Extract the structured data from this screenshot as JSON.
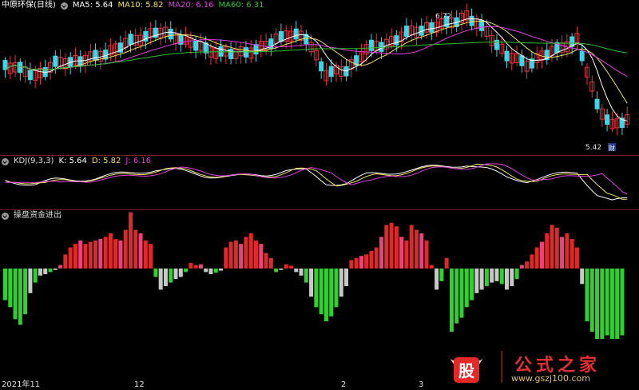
{
  "header_price": {
    "stock": "中原环保(日线)",
    "items": [
      {
        "label": "MA5: 5.64",
        "color": "#ffffff"
      },
      {
        "label": "MA10: 5.82",
        "color": "#f0e060"
      },
      {
        "label": "MA20: 6.16",
        "color": "#e040e0"
      },
      {
        "label": "MA60: 6.31",
        "color": "#30c030"
      }
    ]
  },
  "header_kdj": {
    "name": "KDJ(9,3,3)",
    "items": [
      {
        "label": "K: 5.64",
        "color": "#ffffff"
      },
      {
        "label": "D: 5.82",
        "color": "#f0e060"
      },
      {
        "label": "J: 6.16",
        "color": "#e040e0"
      }
    ]
  },
  "header_fund": {
    "name": "操盘资金进出"
  },
  "annotations": {
    "high": "6.72",
    "low": "5.42",
    "low_tag": "财"
  },
  "x_axis": [
    "2021年11",
    "12",
    "2",
    "3"
  ],
  "watermark": {
    "logo": "股",
    "name": "公式之家",
    "url": "www.gszj100.com"
  },
  "colors": {
    "up": "#e8333a",
    "down": "#38d8e8",
    "ma5": "#ffffff",
    "ma10": "#f0e060",
    "ma20": "#e040e0",
    "ma60": "#30c030",
    "pos": "#e02828",
    "pos2": "#f0407a",
    "neg": "#30d030",
    "neg2": "#c8c8c8"
  },
  "chart_data": [
    {
      "type": "candlestick",
      "title": "中原环保(日线)",
      "price_range": [
        5.42,
        6.72
      ],
      "series": [
        {
          "name": "MA5",
          "value": 5.64
        },
        {
          "name": "MA10",
          "value": 5.82
        },
        {
          "name": "MA20",
          "value": 6.16
        },
        {
          "name": "MA60",
          "value": 6.31
        }
      ]
    },
    {
      "type": "line",
      "title": "KDJ(9,3,3)",
      "series": [
        {
          "name": "K",
          "value": 5.64
        },
        {
          "name": "D",
          "value": 5.82
        },
        {
          "name": "J",
          "value": 6.16
        }
      ]
    },
    {
      "type": "bar",
      "title": "操盘资金进出",
      "values": [
        -0.45,
        -0.55,
        -0.72,
        -0.8,
        -0.65,
        -0.35,
        -0.2,
        -0.1,
        -0.08,
        -0.05,
        -0.02,
        0.05,
        0.2,
        0.3,
        0.35,
        0.4,
        0.35,
        0.38,
        0.4,
        0.42,
        0.45,
        0.5,
        0.42,
        0.4,
        0.55,
        0.8,
        0.55,
        0.5,
        0.4,
        0.35,
        -0.12,
        -0.3,
        -0.25,
        -0.2,
        -0.15,
        -0.12,
        -0.05,
        0.08,
        0.05,
        0.06,
        -0.05,
        -0.08,
        -0.06,
        -0.03,
        0.3,
        0.38,
        0.4,
        0.35,
        0.45,
        0.5,
        0.4,
        0.35,
        0.22,
        0.15,
        -0.05,
        -0.02,
        0.06,
        0.04,
        -0.05,
        -0.1,
        -0.2,
        -0.4,
        -0.55,
        -0.65,
        -0.75,
        -0.68,
        -0.55,
        -0.4,
        -0.25,
        0.12,
        0.15,
        0.18,
        0.2,
        0.25,
        0.3,
        0.45,
        0.62,
        0.65,
        0.6,
        0.45,
        0.4,
        0.62,
        0.55,
        0.5,
        0.4,
        0.05,
        -0.3,
        -0.18,
        0.15,
        -0.9,
        -0.78,
        -0.7,
        -0.55,
        -0.45,
        -0.35,
        -0.3,
        -0.25,
        -0.2,
        -0.18,
        -0.22,
        -0.3,
        -0.25,
        -0.15,
        0.05,
        0.1,
        0.2,
        0.3,
        0.38,
        0.5,
        0.62,
        0.58,
        0.45,
        0.5,
        0.42,
        0.3,
        -0.22,
        -0.75,
        -0.9,
        -1.0,
        -1.0,
        -0.95,
        -1.0,
        -1.0,
        -0.95
      ]
    }
  ]
}
